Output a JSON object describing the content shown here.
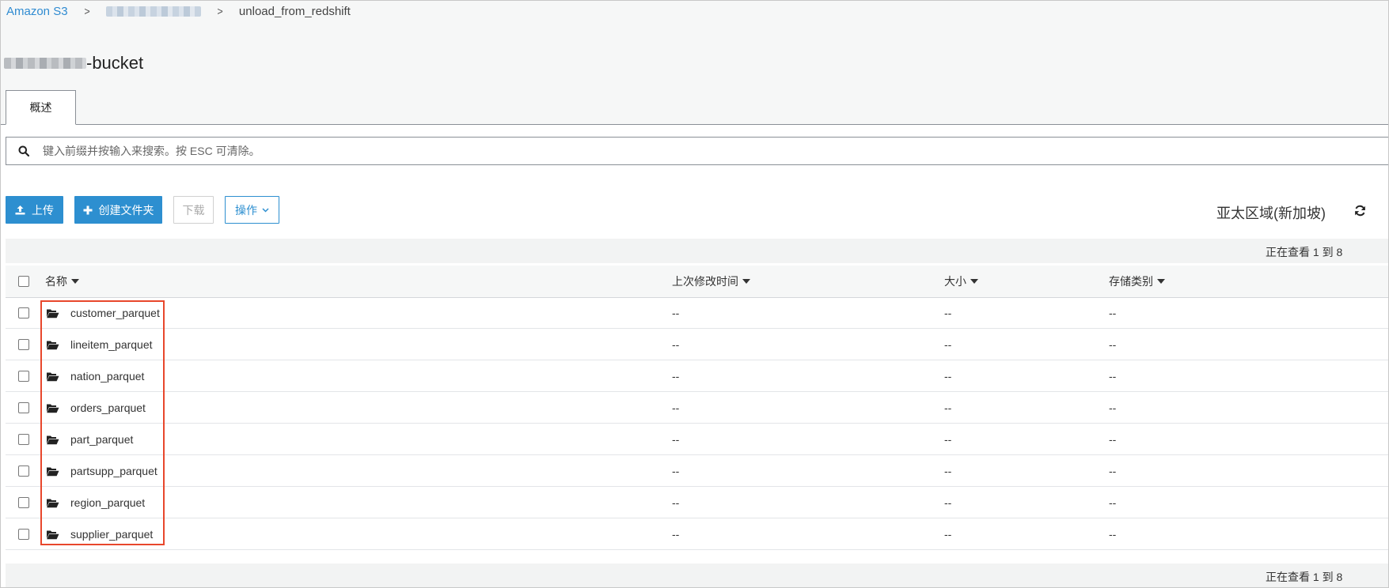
{
  "breadcrumb": {
    "root_label": "Amazon S3",
    "separator": ">",
    "current_label": "unload_from_redshift"
  },
  "bucket": {
    "name_suffix": "-bucket"
  },
  "tabs": [
    {
      "label": "概述"
    }
  ],
  "search": {
    "placeholder": "键入前缀并按输入来搜索。按 ESC 可清除。",
    "value": ""
  },
  "toolbar": {
    "upload_label": "上传",
    "create_folder_label": "创建文件夹",
    "download_label": "下载",
    "actions_label": "操作"
  },
  "region_label": "亚太区域(新加坡)",
  "pager": {
    "text": "正在查看 1 到 8"
  },
  "table": {
    "columns": [
      "名称",
      "上次修改时间",
      "大小",
      "存储类别"
    ],
    "rows": [
      {
        "name": "customer_parquet",
        "modified": "--",
        "size": "--",
        "storage": "--"
      },
      {
        "name": "lineitem_parquet",
        "modified": "--",
        "size": "--",
        "storage": "--"
      },
      {
        "name": "nation_parquet",
        "modified": "--",
        "size": "--",
        "storage": "--"
      },
      {
        "name": "orders_parquet",
        "modified": "--",
        "size": "--",
        "storage": "--"
      },
      {
        "name": "part_parquet",
        "modified": "--",
        "size": "--",
        "storage": "--"
      },
      {
        "name": "partsupp_parquet",
        "modified": "--",
        "size": "--",
        "storage": "--"
      },
      {
        "name": "region_parquet",
        "modified": "--",
        "size": "--",
        "storage": "--"
      },
      {
        "name": "supplier_parquet",
        "modified": "--",
        "size": "--",
        "storage": "--"
      }
    ]
  },
  "colors": {
    "link": "#2f8bd1",
    "primary_button": "#2d8fd0",
    "highlight_border": "#e8472c"
  },
  "icons": {
    "upload": "upload-icon",
    "create_folder": "plus-icon",
    "actions": "chevron-down-icon",
    "refresh": "refresh-icon",
    "search": "search-icon",
    "folder": "folder-open-icon"
  }
}
